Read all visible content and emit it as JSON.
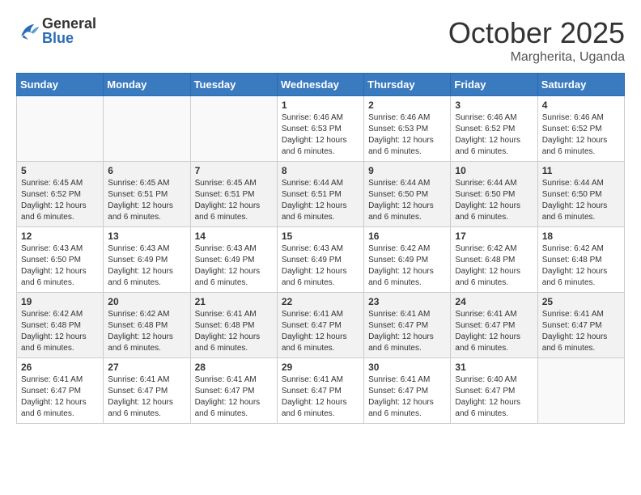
{
  "header": {
    "logo_general": "General",
    "logo_blue": "Blue",
    "month": "October 2025",
    "location": "Margherita, Uganda"
  },
  "weekdays": [
    "Sunday",
    "Monday",
    "Tuesday",
    "Wednesday",
    "Thursday",
    "Friday",
    "Saturday"
  ],
  "weeks": [
    [
      {
        "day": "",
        "info": ""
      },
      {
        "day": "",
        "info": ""
      },
      {
        "day": "",
        "info": ""
      },
      {
        "day": "1",
        "info": "Sunrise: 6:46 AM\nSunset: 6:53 PM\nDaylight: 12 hours and 6 minutes."
      },
      {
        "day": "2",
        "info": "Sunrise: 6:46 AM\nSunset: 6:53 PM\nDaylight: 12 hours and 6 minutes."
      },
      {
        "day": "3",
        "info": "Sunrise: 6:46 AM\nSunset: 6:52 PM\nDaylight: 12 hours and 6 minutes."
      },
      {
        "day": "4",
        "info": "Sunrise: 6:46 AM\nSunset: 6:52 PM\nDaylight: 12 hours and 6 minutes."
      }
    ],
    [
      {
        "day": "5",
        "info": "Sunrise: 6:45 AM\nSunset: 6:52 PM\nDaylight: 12 hours and 6 minutes."
      },
      {
        "day": "6",
        "info": "Sunrise: 6:45 AM\nSunset: 6:51 PM\nDaylight: 12 hours and 6 minutes."
      },
      {
        "day": "7",
        "info": "Sunrise: 6:45 AM\nSunset: 6:51 PM\nDaylight: 12 hours and 6 minutes."
      },
      {
        "day": "8",
        "info": "Sunrise: 6:44 AM\nSunset: 6:51 PM\nDaylight: 12 hours and 6 minutes."
      },
      {
        "day": "9",
        "info": "Sunrise: 6:44 AM\nSunset: 6:50 PM\nDaylight: 12 hours and 6 minutes."
      },
      {
        "day": "10",
        "info": "Sunrise: 6:44 AM\nSunset: 6:50 PM\nDaylight: 12 hours and 6 minutes."
      },
      {
        "day": "11",
        "info": "Sunrise: 6:44 AM\nSunset: 6:50 PM\nDaylight: 12 hours and 6 minutes."
      }
    ],
    [
      {
        "day": "12",
        "info": "Sunrise: 6:43 AM\nSunset: 6:50 PM\nDaylight: 12 hours and 6 minutes."
      },
      {
        "day": "13",
        "info": "Sunrise: 6:43 AM\nSunset: 6:49 PM\nDaylight: 12 hours and 6 minutes."
      },
      {
        "day": "14",
        "info": "Sunrise: 6:43 AM\nSunset: 6:49 PM\nDaylight: 12 hours and 6 minutes."
      },
      {
        "day": "15",
        "info": "Sunrise: 6:43 AM\nSunset: 6:49 PM\nDaylight: 12 hours and 6 minutes."
      },
      {
        "day": "16",
        "info": "Sunrise: 6:42 AM\nSunset: 6:49 PM\nDaylight: 12 hours and 6 minutes."
      },
      {
        "day": "17",
        "info": "Sunrise: 6:42 AM\nSunset: 6:48 PM\nDaylight: 12 hours and 6 minutes."
      },
      {
        "day": "18",
        "info": "Sunrise: 6:42 AM\nSunset: 6:48 PM\nDaylight: 12 hours and 6 minutes."
      }
    ],
    [
      {
        "day": "19",
        "info": "Sunrise: 6:42 AM\nSunset: 6:48 PM\nDaylight: 12 hours and 6 minutes."
      },
      {
        "day": "20",
        "info": "Sunrise: 6:42 AM\nSunset: 6:48 PM\nDaylight: 12 hours and 6 minutes."
      },
      {
        "day": "21",
        "info": "Sunrise: 6:41 AM\nSunset: 6:48 PM\nDaylight: 12 hours and 6 minutes."
      },
      {
        "day": "22",
        "info": "Sunrise: 6:41 AM\nSunset: 6:47 PM\nDaylight: 12 hours and 6 minutes."
      },
      {
        "day": "23",
        "info": "Sunrise: 6:41 AM\nSunset: 6:47 PM\nDaylight: 12 hours and 6 minutes."
      },
      {
        "day": "24",
        "info": "Sunrise: 6:41 AM\nSunset: 6:47 PM\nDaylight: 12 hours and 6 minutes."
      },
      {
        "day": "25",
        "info": "Sunrise: 6:41 AM\nSunset: 6:47 PM\nDaylight: 12 hours and 6 minutes."
      }
    ],
    [
      {
        "day": "26",
        "info": "Sunrise: 6:41 AM\nSunset: 6:47 PM\nDaylight: 12 hours and 6 minutes."
      },
      {
        "day": "27",
        "info": "Sunrise: 6:41 AM\nSunset: 6:47 PM\nDaylight: 12 hours and 6 minutes."
      },
      {
        "day": "28",
        "info": "Sunrise: 6:41 AM\nSunset: 6:47 PM\nDaylight: 12 hours and 6 minutes."
      },
      {
        "day": "29",
        "info": "Sunrise: 6:41 AM\nSunset: 6:47 PM\nDaylight: 12 hours and 6 minutes."
      },
      {
        "day": "30",
        "info": "Sunrise: 6:41 AM\nSunset: 6:47 PM\nDaylight: 12 hours and 6 minutes."
      },
      {
        "day": "31",
        "info": "Sunrise: 6:40 AM\nSunset: 6:47 PM\nDaylight: 12 hours and 6 minutes."
      },
      {
        "day": "",
        "info": ""
      }
    ]
  ]
}
